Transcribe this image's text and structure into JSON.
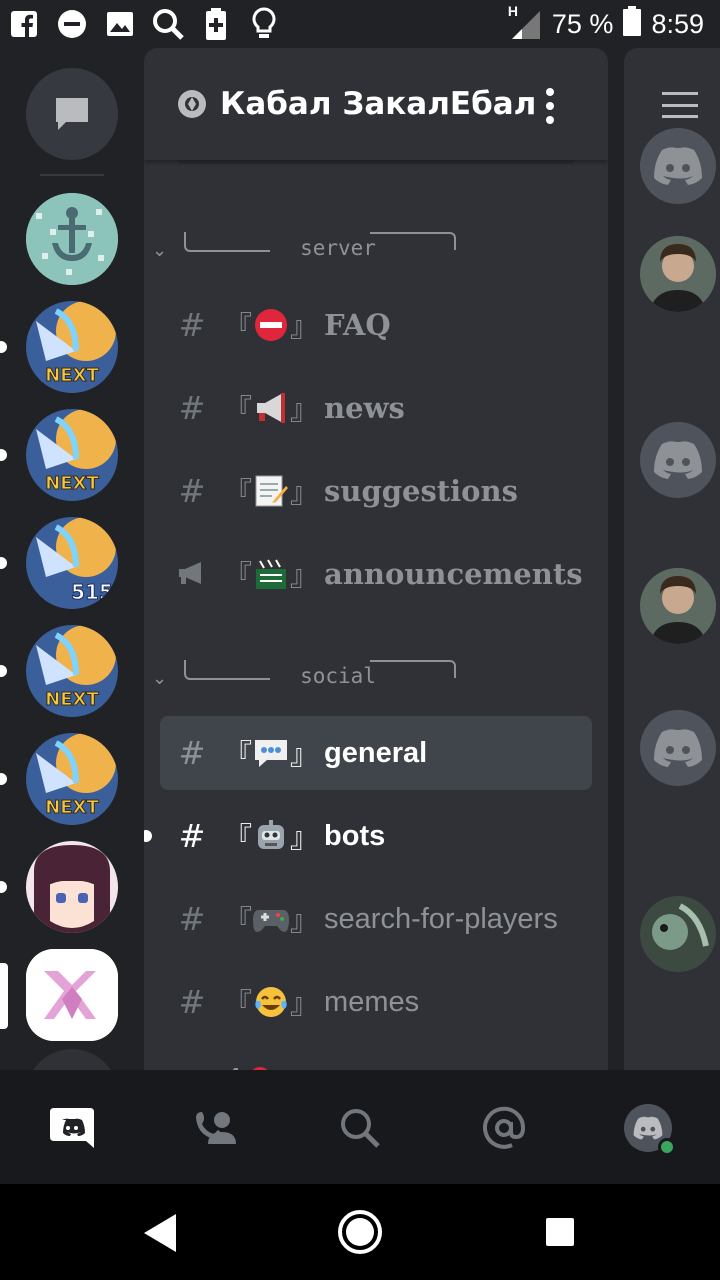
{
  "status_bar": {
    "icons": [
      "facebook-icon",
      "do-not-disturb-icon",
      "image-icon",
      "search-icon",
      "battery-saver-icon",
      "lightbulb-icon"
    ],
    "network": "H",
    "battery": "75 %",
    "time": "8:59"
  },
  "server_rail": {
    "items": [
      {
        "name": "direct-messages",
        "unread": false
      },
      {
        "name": "anchor-server",
        "unread": false
      },
      {
        "name": "next-server-1",
        "unread": true
      },
      {
        "name": "next-server-2",
        "unread": true
      },
      {
        "name": "515-server",
        "unread": true
      },
      {
        "name": "next-server-3",
        "unread": true
      },
      {
        "name": "next-server-4",
        "unread": true
      },
      {
        "name": "anime-server",
        "unread": true
      },
      {
        "name": "pink-logo-server",
        "selected": true
      }
    ]
  },
  "header": {
    "server_name": "Кабал ЗакалЕбал"
  },
  "categories": {
    "server": "server",
    "social": "social"
  },
  "channels": [
    {
      "name": "FAQ",
      "emoji": "⛔",
      "icon": "hash",
      "font": "serif"
    },
    {
      "name": "news",
      "emoji": "📢",
      "icon": "hash",
      "font": "serif"
    },
    {
      "name": "suggestions",
      "emoji": "📝",
      "icon": "hash",
      "font": "serif"
    },
    {
      "name": "announcements",
      "emoji": "🎬",
      "icon": "megaphone",
      "font": "serif"
    },
    {
      "name": "general",
      "emoji": "💬",
      "icon": "hash",
      "font": "sans",
      "selected": true
    },
    {
      "name": "bots",
      "emoji": "🤖",
      "icon": "hash",
      "font": "sans",
      "unread": true
    },
    {
      "name": "search-for-players",
      "emoji": "🎮",
      "icon": "hash",
      "font": "sans"
    },
    {
      "name": "memes",
      "emoji": "😂",
      "icon": "hash",
      "font": "sans"
    }
  ],
  "bracket_open": "『",
  "bracket_close": "』",
  "hash_symbol": "#",
  "bottom_nav": [
    "discord-home-icon",
    "friends-icon",
    "search-icon",
    "mentions-icon",
    "profile-icon"
  ],
  "colors": {
    "background": "#202225",
    "panel": "#2f3136",
    "selected": "#40444b",
    "muted_text": "#8e9297",
    "online": "#3ba55d",
    "blurple": "#7289da"
  }
}
